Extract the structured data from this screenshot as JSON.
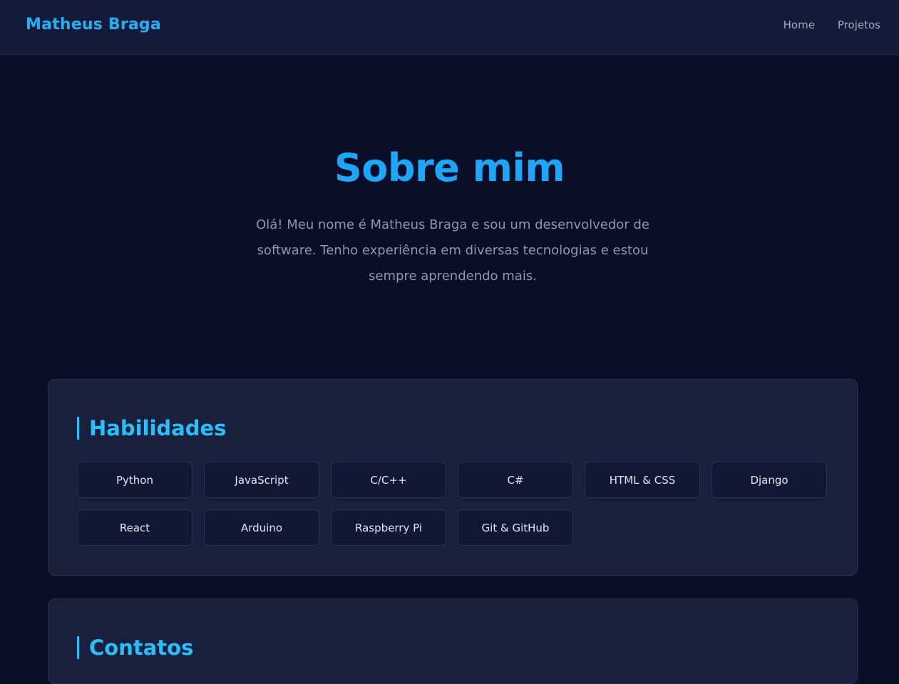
{
  "nav": {
    "brand": "Matheus Braga",
    "links": [
      {
        "label": "Home"
      },
      {
        "label": "Projetos"
      }
    ]
  },
  "hero": {
    "title": "Sobre mim",
    "description": "Olá! Meu nome é Matheus Braga e sou um desenvolvedor de software. Tenho experiência em diversas tecnologias e estou sempre aprendendo mais."
  },
  "skills": {
    "heading": "Habilidades",
    "items": [
      "Python",
      "JavaScript",
      "C/C++",
      "C#",
      "HTML & CSS",
      "Django",
      "React",
      "Arduino",
      "Raspberry Pi",
      "Git & GitHub"
    ]
  },
  "contacts": {
    "heading": "Contatos"
  },
  "colors": {
    "background": "#0a0e27",
    "navbar": "#141a37",
    "card": "#1a1f3c",
    "accent": "#1aa8ff"
  }
}
